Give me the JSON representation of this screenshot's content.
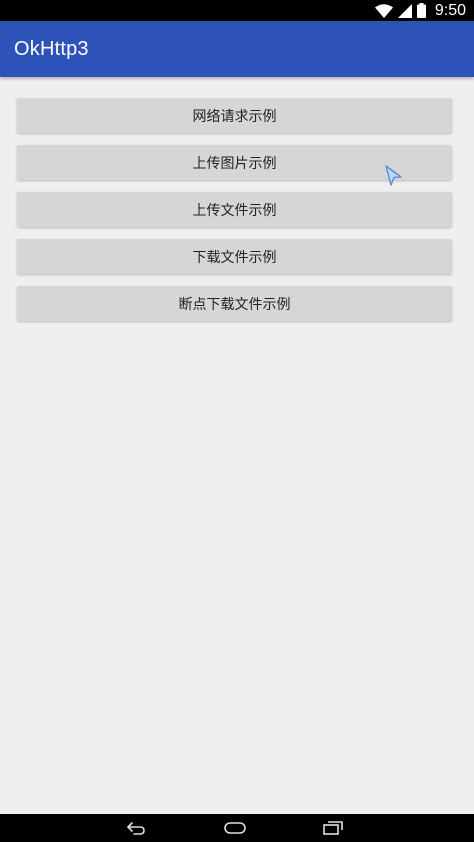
{
  "status_bar": {
    "time": "9:50",
    "icons": [
      "wifi-icon",
      "signal-icon",
      "battery-icon"
    ]
  },
  "app_bar": {
    "title": "OkHttp3",
    "color": "#2d52b8"
  },
  "buttons": [
    {
      "label": "网络请求示例"
    },
    {
      "label": "上传图片示例"
    },
    {
      "label": "上传文件示例"
    },
    {
      "label": "下载文件示例"
    },
    {
      "label": "断点下载文件示例"
    }
  ],
  "nav_bar": {
    "icons": [
      "back-icon",
      "home-icon",
      "recent-apps-icon"
    ]
  },
  "colors": {
    "background": "#efefef",
    "button": "#d6d6d6",
    "button_text": "#222222"
  }
}
